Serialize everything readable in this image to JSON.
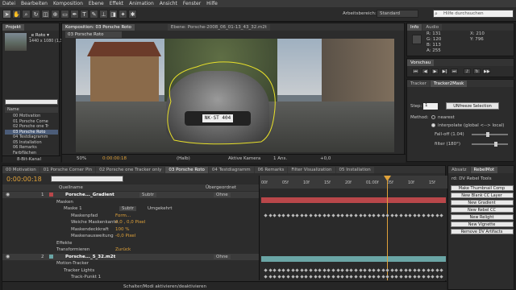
{
  "menu": [
    "Datei",
    "Bearbeiten",
    "Komposition",
    "Ebene",
    "Effekt",
    "Animation",
    "Ansicht",
    "Fenster",
    "Hilfe"
  ],
  "workspace": {
    "label": "Arbeitsbereich:",
    "value": "Standard",
    "help_placeholder": "Hilfe durchsuchen"
  },
  "project": {
    "tab": "Projekt",
    "thumb_name": "_e Roto ▾",
    "thumb_info": "1440 x 1080 (1,33)",
    "items": [
      "00 Motivation",
      "01 Porsche Corne",
      "02 Porsche one Tr",
      "03 Porsche Roto",
      "04 Testdiagramm",
      "05 Installation",
      "06 Remarks",
      "Farbflächen"
    ],
    "active_index": 3,
    "bit_depth": "8-Bit-Kanal"
  },
  "comp": {
    "title": "Komposition: 03 Porsche Roto",
    "layer_tab": "Ebene: Porsche-2008_06_01-13_43_32.m2t",
    "viewer_tab": "03 Porsche Roto",
    "plate": "NK·ST 404",
    "zoom": "50%",
    "timecode": "0:00:00:18",
    "resolution": "(Halb)",
    "camera": "Aktive Kamera",
    "views": "1 Ans.",
    "exposure": "+0,0"
  },
  "info": {
    "tabs": [
      "Info",
      "Audio"
    ],
    "r": "R: 131",
    "g": "G: 120",
    "b": "B: 113",
    "a": "A: 255",
    "x": "X: 210",
    "y": "Y: 796"
  },
  "preview_tab": "Vorschau",
  "tracker": {
    "tabs": [
      "Tracker",
      "Tracker2Mask"
    ],
    "step_label": "Step:",
    "step_value": "1",
    "button": "UNfreeze Selection",
    "method_label": "Method:",
    "nearest": "nearest",
    "interpolate": "interpolate  (global <--> local)",
    "falloff": "Fall-off (1.04)",
    "filter": "filter (180°)"
  },
  "right": {
    "tabs": [
      "Absatz",
      "RebelMot"
    ],
    "title": "rd: DV Rebel Tools",
    "buttons": [
      "Make Thumbnail Comp",
      "New Blank CC Layer",
      "New Gradient",
      "New Rebel CC",
      "New Relight",
      "New Vignette",
      "Remove DV Artifacts"
    ]
  },
  "timeline": {
    "tabs": [
      "00 Motivation",
      "01 Porsche Corner Pin",
      "02 Porsche one Tracker only",
      "03 Porsche Roto",
      "04 Testdiagramm",
      "06 Remarks",
      "Filter Visualization",
      "05 Installation"
    ],
    "active_tab": 3,
    "timecode": "0:00:00:18",
    "col_name": "Quellname",
    "col_parent": "Übergeordnet",
    "ruler": [
      "00f",
      "05f",
      "10f",
      "15f",
      "20f",
      "01:00f",
      "05f",
      "10f",
      "15f"
    ],
    "rows": [
      {
        "num": "1",
        "name": "Porsche..._Gradient",
        "mode": "Subtr",
        "parent": "Ohne",
        "level": 0
      },
      {
        "name": "Masken",
        "level": 1
      },
      {
        "name": "Maske 1",
        "mode": "Subtr",
        "extra": "Umgekehrt",
        "level": 2
      },
      {
        "name": "Maskenpfad",
        "value": "Form...",
        "level": 3
      },
      {
        "name": "Weiche Maskenkante",
        "value": "0,0 , 0,0 Pixel",
        "level": 3
      },
      {
        "name": "Maskendeckkraft",
        "value": "100 %",
        "level": 3
      },
      {
        "name": "Maskenausweitung",
        "value": "-0,0 Pixel",
        "level": 3
      },
      {
        "name": "Effekte",
        "level": 1
      },
      {
        "name": "Transformieren",
        "value": "Zurück",
        "level": 1
      },
      {
        "num": "2",
        "name": "Porsche..._5_32.m2t",
        "parent": "Ohne",
        "level": 0
      },
      {
        "name": "Motion-Tracker",
        "level": 1
      },
      {
        "name": "Tracker Lights",
        "level": 2
      },
      {
        "name": "Track-Punkt 1",
        "level": 3
      }
    ],
    "bottom": "Schalter/Modi aktivieren/deaktivieren"
  },
  "colors": {
    "accent": "#e0a23a",
    "timeline_red": "#b9474a",
    "timeline_teal": "#6aa5a5",
    "mask": "#e8e02a"
  }
}
